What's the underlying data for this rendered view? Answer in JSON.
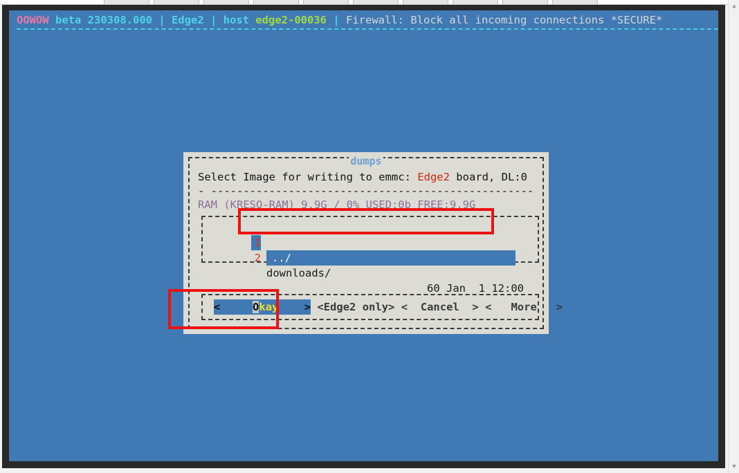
{
  "window": {
    "chrome_tab_count": 10
  },
  "terminal": {
    "status": {
      "brand": "OOWOW",
      "version": "beta 230308.000",
      "sep1": " | ",
      "board": "Edge2",
      "sep2": " | ",
      "host_label": "host",
      "host_name": "edge2-00036",
      "sep3": " | ",
      "firewall": "Firewall: Block all incoming connections *SECURE*"
    },
    "colors": {
      "background": "#4179b4",
      "brand": "#e27ba8",
      "cyan": "#4fd2e8",
      "green": "#9fd94a",
      "grey": "#d2d8dc",
      "dialog_bg": "#dcdcd4",
      "selection": "#4179b4",
      "annotation": "#ee1111",
      "red_text": "#c73a22",
      "yellow_hot": "#f0e020"
    }
  },
  "dialog": {
    "title": "dumps",
    "prompt_prefix": "Select Image for writing to emmc: ",
    "prompt_board": "Edge2",
    "prompt_suffix": " board, DL:0",
    "divider": "- ------------------------------------------------------",
    "ram_line": "RAM (KRESQ-RAM) 9.9G / 0% USED:0b FREE:9.9G",
    "list": {
      "rows": [
        {
          "num": "1",
          "name": "../",
          "meta": "",
          "selected": true
        },
        {
          "num": "2",
          "name": "downloads/",
          "meta": "60 Jan  1 12:00",
          "selected": false
        }
      ]
    },
    "buttons": [
      {
        "name": "okay",
        "open": "<",
        "pre": "     ",
        "hotkey": "O",
        "rest": "kay",
        "post": "    ",
        "close": ">",
        "focused": true
      },
      {
        "name": "edge2-only",
        "open": "<",
        "pre": "",
        "hotkey": "",
        "rest": "Edge2 only",
        "post": "",
        "close": ">",
        "focused": false
      },
      {
        "name": "cancel",
        "open": "<",
        "pre": "  ",
        "hotkey": "",
        "rest": "Cancel",
        "post": "  ",
        "close": ">",
        "focused": false
      },
      {
        "name": "more",
        "open": "<",
        "pre": "   ",
        "hotkey": "",
        "rest": "More",
        "post": "   ",
        "close": ">",
        "focused": false
      }
    ]
  },
  "annotations": [
    {
      "name": "highlight-selected-file-row",
      "color": "#ee1111"
    },
    {
      "name": "highlight-okay-button",
      "color": "#ee1111"
    }
  ],
  "scrollbar": {
    "up_glyph": "▲",
    "down_glyph": "▼"
  }
}
